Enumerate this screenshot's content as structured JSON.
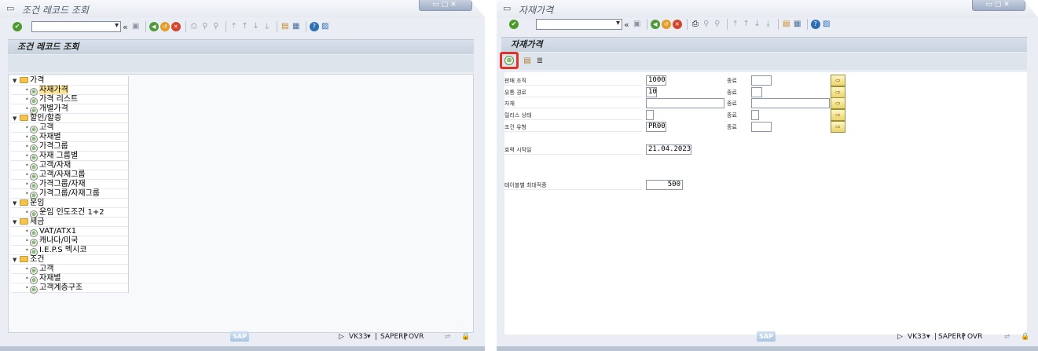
{
  "left": {
    "window_title": "조건 레코드 조회",
    "panel_title": "조건 레코드 조회",
    "tree": [
      {
        "type": "folder",
        "label": "가격"
      },
      {
        "type": "leaf",
        "label": "자재가격",
        "selected": true
      },
      {
        "type": "leaf",
        "label": "가격 리스트"
      },
      {
        "type": "leaf",
        "label": "개별가격"
      },
      {
        "type": "folder",
        "label": "할인/할증"
      },
      {
        "type": "leaf",
        "label": "고객"
      },
      {
        "type": "leaf",
        "label": "자재별"
      },
      {
        "type": "leaf",
        "label": "가격그룹"
      },
      {
        "type": "leaf",
        "label": "자재 그룹별"
      },
      {
        "type": "leaf",
        "label": "고객/자재"
      },
      {
        "type": "leaf",
        "label": "고객/자재그룹"
      },
      {
        "type": "leaf",
        "label": "가격그룹/자재"
      },
      {
        "type": "leaf",
        "label": "가격그룹/자재그룹"
      },
      {
        "type": "folder",
        "label": "운임"
      },
      {
        "type": "leaf",
        "label": "운임 인도조건 1+2"
      },
      {
        "type": "folder",
        "label": "세금"
      },
      {
        "type": "leaf",
        "label": "VAT/ATX1"
      },
      {
        "type": "leaf",
        "label": "캐나다/미국"
      },
      {
        "type": "leaf",
        "label": "I.E.P.S 멕시코"
      },
      {
        "type": "folder",
        "label": "조건"
      },
      {
        "type": "leaf",
        "label": "고객"
      },
      {
        "type": "leaf",
        "label": "자재별"
      },
      {
        "type": "leaf",
        "label": "고객계층구조"
      }
    ],
    "status": {
      "tcode": "VK33",
      "system": "SAPERP",
      "mode": "OVR",
      "logo": "SAP"
    }
  },
  "right": {
    "window_title": "자재가격",
    "panel_title": "자재가격",
    "fields": [
      {
        "label": "판매 조직",
        "value": "1000",
        "to_label": "종료",
        "to_value": ""
      },
      {
        "label": "유통 경로",
        "value": "10",
        "to_label": "종료",
        "to_value": ""
      },
      {
        "label": "자재",
        "value": "",
        "to_label": "종료",
        "to_value": ""
      },
      {
        "label": "릴리스 상태",
        "value": "",
        "to_label": "종료",
        "to_value": ""
      },
      {
        "label": "조건 유형",
        "value": "PR00",
        "to_label": "종료",
        "to_value": ""
      }
    ],
    "valid_from_label": "효력 시작일",
    "valid_from_value": "21.04.2023",
    "max_hits_label": "테이블별 최대적중",
    "max_hits_value": "500",
    "status": {
      "tcode": "VK33",
      "system": "SAPERP",
      "mode": "OVR",
      "logo": "SAP"
    }
  },
  "colors": {
    "highlight": "#e0322a",
    "selection": "#fce59a"
  }
}
